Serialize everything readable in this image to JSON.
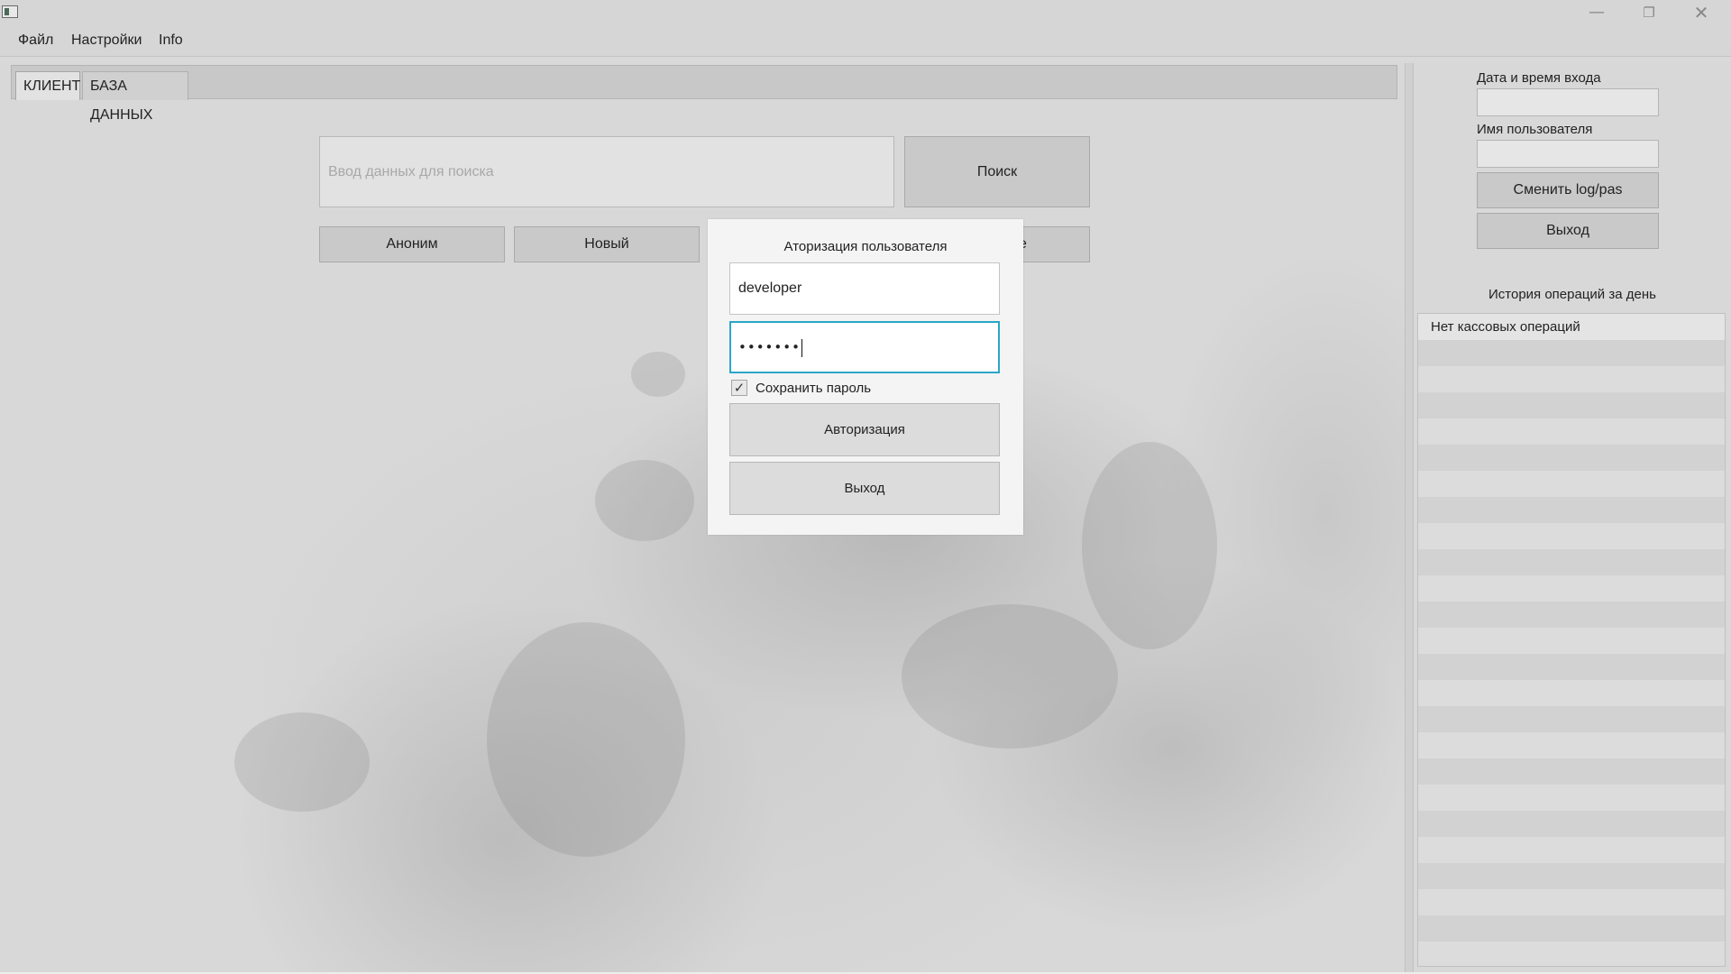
{
  "window": {
    "minimize": "—",
    "maximize": "❐",
    "close": "✕"
  },
  "menu": {
    "file": "Файл",
    "settings": "Настройки",
    "info": "Info"
  },
  "tabs": {
    "client": "КЛИЕНТ",
    "database": "БАЗА ДАННЫХ"
  },
  "search": {
    "placeholder": "Ввод данных для поиска",
    "value": "",
    "button": "Поиск"
  },
  "actions": {
    "anonymous": "Аноним",
    "new": "Новый",
    "partial_hidden": "е"
  },
  "sidebar": {
    "login_time_label": "Дата и время входа",
    "login_time_value": "",
    "username_label": "Имя пользователя",
    "username_value": "",
    "change_credentials": "Сменить log/pas",
    "logout": "Выход",
    "history_title": "История операций за день",
    "history_items": [
      "Нет кассовых операций"
    ]
  },
  "login_dialog": {
    "title": "Аторизация пользователя",
    "username": "developer",
    "password_masked": "•••••••",
    "remember_label": "Сохранить пароль",
    "remember_checked": true,
    "checkmark": "✓",
    "auth_button": "Авторизация",
    "exit_button": "Выход",
    "focus_color": "#2aa6c8"
  }
}
